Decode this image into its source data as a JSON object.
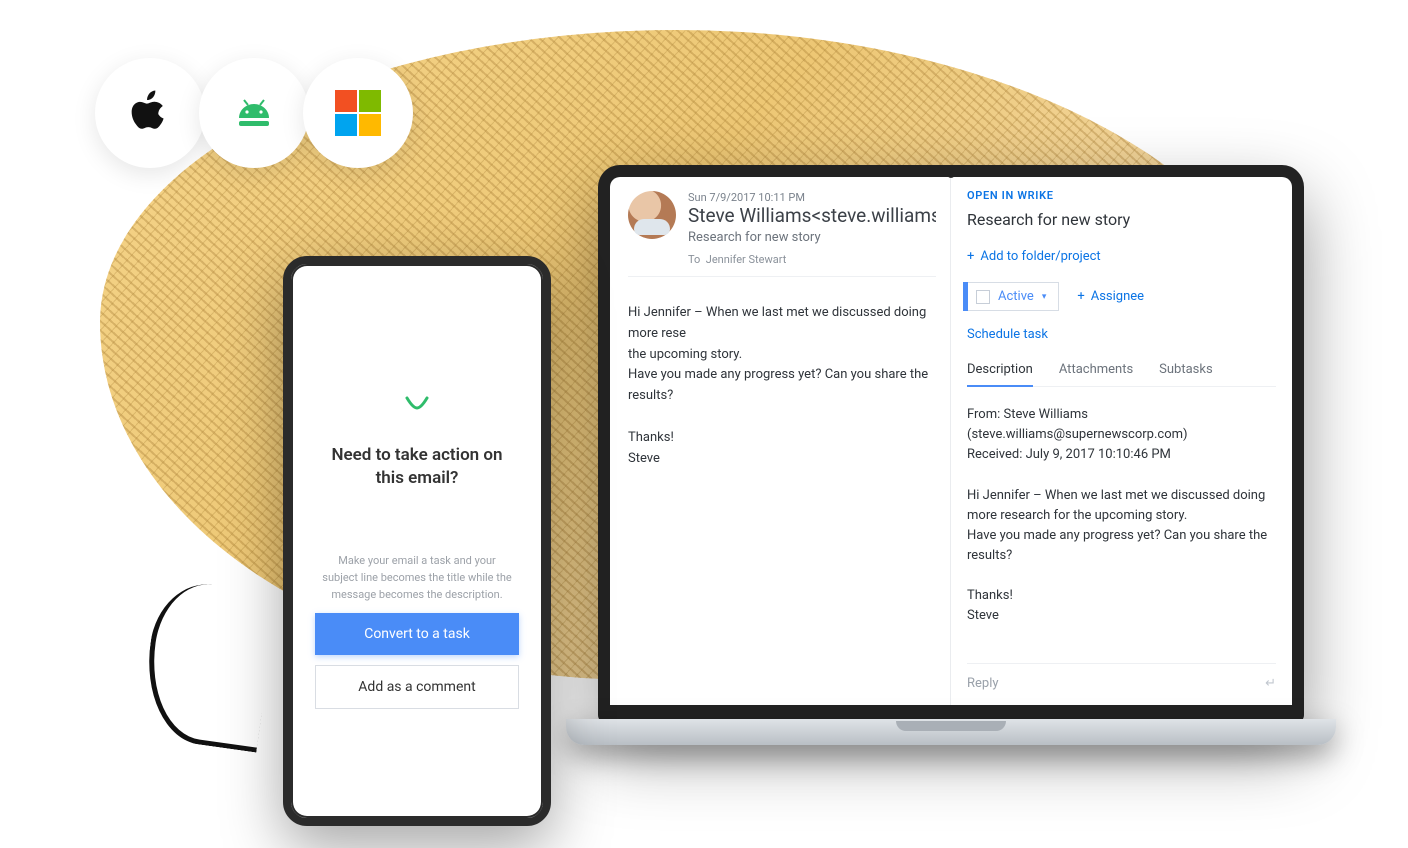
{
  "platforms": {
    "apple": "apple-icon",
    "android": "android-icon",
    "microsoft": "microsoft-icon"
  },
  "phone": {
    "title": "Need to take action on this email?",
    "subtitle": "Make your email a task and your subject line becomes the title while the message becomes the description.",
    "primary_btn": "Convert to a task",
    "secondary_btn": "Add as a comment"
  },
  "email": {
    "date": "Sun 7/9/2017 10:11 PM",
    "from_display": "Steve Williams<steve.williams",
    "subject": "Research for new story",
    "to_label": "To",
    "to_value": "Jennifer Stewart",
    "body": "Hi Jennifer – When we last met we discussed doing more rese\nthe upcoming story.\nHave you made any progress yet? Can you share the results?\n\nThanks!\nSteve"
  },
  "wrike": {
    "open_label": "OPEN IN WRIKE",
    "task_title": "Research for new story",
    "add_folder": "Add to folder/project",
    "status_label": "Active",
    "assignee_label": "Assignee",
    "schedule_label": "Schedule task",
    "tabs": {
      "description": "Description",
      "attachments": "Attachments",
      "subtasks": "Subtasks"
    },
    "description_body": "From: Steve Williams\n(steve.williams@supernewscorp.com)\nReceived: July 9, 2017 10:10:46 PM\n\nHi Jennifer – When we last met we discussed doing more research for the upcoming story.\nHave you made any progress yet? Can you share the results?\n\nThanks!\nSteve",
    "reply_placeholder": "Reply"
  }
}
